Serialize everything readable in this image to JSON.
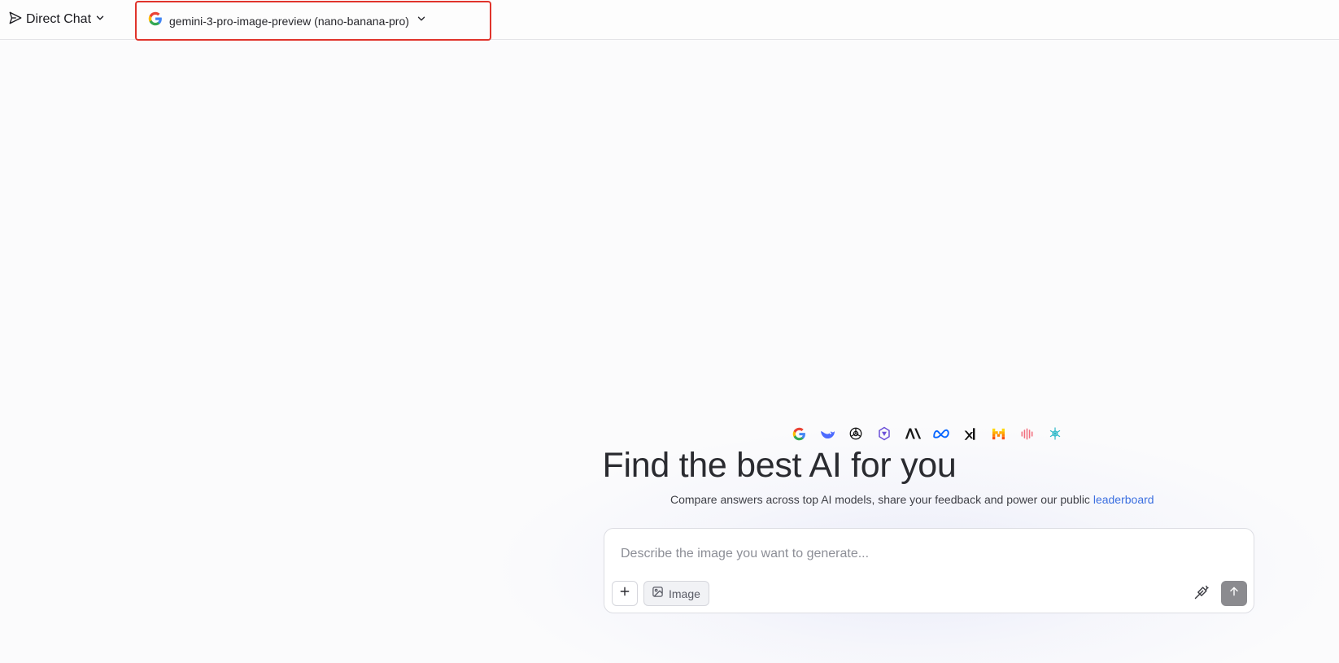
{
  "topbar": {
    "mode_label": "Direct Chat",
    "model_label": "gemini-3-pro-image-preview (nano-banana-pro)"
  },
  "hero": {
    "provider_logos": [
      "google-logo-icon",
      "deepseek-logo-icon",
      "openai-logo-icon",
      "provider-logo-icon",
      "anthropic-logo-icon",
      "meta-logo-icon",
      "xai-logo-icon",
      "mistral-logo-icon",
      "provider-logo-icon",
      "provider-logo-icon"
    ],
    "headline": "Find the best AI for you",
    "subtitle": "Compare answers across top AI models, share your feedback and power our public",
    "subtitle_link": "leaderboard"
  },
  "composer": {
    "placeholder": "Describe the image you want to generate...",
    "image_button_label": "Image"
  },
  "colors": {
    "accent_link": "#3b6fe0",
    "highlight_border": "#e0342c",
    "send_button": "#8b8b8f"
  }
}
